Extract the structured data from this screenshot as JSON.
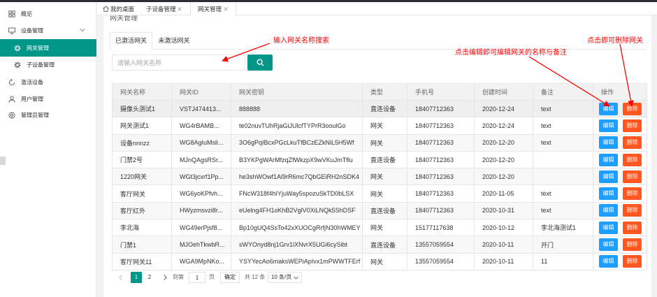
{
  "theme": {
    "accent": "#009688",
    "edit_button": "#1E9FFF",
    "delete_button": "#FF5722",
    "annotation": "#FF0000"
  },
  "sidebar": {
    "items": [
      {
        "label": "概览",
        "icon": "grid-icon"
      },
      {
        "label": "设备管理",
        "icon": "monitor-icon",
        "expanded": true
      },
      {
        "label": "网关管理",
        "icon": "gear-icon",
        "active": true
      },
      {
        "label": "子设备管理",
        "icon": "gear-icon"
      },
      {
        "label": "激活设备",
        "icon": "refresh-circle-icon"
      },
      {
        "label": "用户管理",
        "icon": "user-icon"
      },
      {
        "label": "管理员管理",
        "icon": "settings-circle-icon"
      }
    ]
  },
  "tabbar": {
    "tabs": [
      {
        "label": "我的桌面",
        "icon": "home-icon"
      },
      {
        "label": "子设备管理",
        "closable": true
      },
      {
        "label": "网关管理",
        "closable": true,
        "active": true
      }
    ]
  },
  "page": {
    "title": "网关管理"
  },
  "subtabs": [
    {
      "label": "已激活网关",
      "active": true
    },
    {
      "label": "未激活网关"
    }
  ],
  "search": {
    "placeholder": "请输入网关名称",
    "button_icon": "search-icon"
  },
  "annotations": {
    "search_hint": "输入网关名称搜索",
    "edit_hint": "点击编辑即可编辑网关的名称与备注",
    "delete_hint": "点击即可删除网关"
  },
  "table": {
    "columns": [
      "网关名称",
      "网关ID",
      "网关密钥",
      "类型",
      "手机号",
      "创建时间",
      "备注",
      "操作"
    ],
    "rows": [
      [
        "摄像头测试1",
        "VSTJ474413...",
        "888888",
        "直连设备",
        "18407712363",
        "2020-12-24",
        "text"
      ],
      [
        "网关测试1",
        "WG4rBAMB...",
        "te02nuvTUhRjaGiJUlcfTYPrR3ooulGo",
        "网关",
        "18407712363",
        "2020-12-24",
        "text"
      ],
      [
        "设备nnnzz",
        "WG8AgIuMsli...",
        "3O6gPqIBcxPGcLkuTfBCzEZkNiL5H5Wf",
        "网关",
        "18407712363",
        "2020-12-20",
        "text"
      ],
      [
        "门禁2号",
        "MJnQAgsRSr...",
        "B3YKPgWArMfzqZfWkzpX9wVKuJmTflu",
        "直连设备",
        "18407712363",
        "2020-12-20",
        ""
      ],
      [
        "1220网关",
        "WGt3jcxrf1Pp...",
        "he3shWOwf1Al9rR6mc7QbGEiRH2nSDK4",
        "网关",
        "18407712363",
        "2020-12-20",
        ""
      ],
      [
        "客厅网关",
        "WG6yoKPfvh...",
        "FNcW318f4hIYjuWay5spozuSkTD0bLSX",
        "网关",
        "18407712363",
        "2020-11-05",
        "text"
      ],
      [
        "客厅红外",
        "HWyzmsvzi8r...",
        "eUelng4FH1oKhB2VglV0XiLNQk5ShDSF",
        "直连设备",
        "18407712363",
        "2020-10-31",
        "text"
      ],
      [
        "李北海",
        "WG49erPjsf8...",
        "Bp10gUQ4SsTo42xXUOCgRrfjN30hWMEY",
        "网关",
        "15177117638",
        "2020-10-12",
        "李北海测试1"
      ],
      [
        "门禁1",
        "MJOehTkwbR...",
        "sWYOnyd8nj1Grv1lXNvrX5UGi6cySibt",
        "直连设备",
        "13557059554",
        "2020-10-11",
        "开门"
      ],
      [
        "客厅网关11",
        "WGA9MpNKo...",
        "YSYYecAo6maksWEPiApIvx1mPWWTFErf",
        "网关",
        "13557059554",
        "2020-10-11",
        "11"
      ]
    ],
    "actions": {
      "edit": "编辑",
      "delete": "删除"
    }
  },
  "pagination": {
    "pages": [
      "1",
      "2"
    ],
    "jump_prefix": "到第",
    "jump_value": "1",
    "jump_suffix": "页",
    "confirm_label": "确定",
    "total_text": "共 12 条",
    "page_size": "10 条/页"
  }
}
